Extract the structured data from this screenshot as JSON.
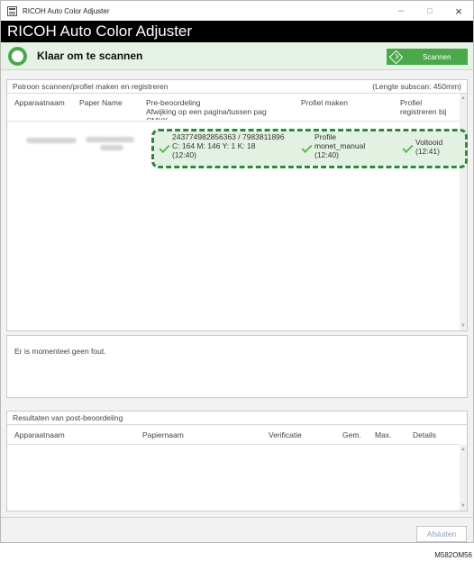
{
  "window": {
    "title": "RICOH Auto Color Adjuster",
    "controls": {
      "minimize": "–",
      "maximize": "□",
      "close": "×"
    }
  },
  "header": {
    "title": "RICOH Auto Color Adjuster"
  },
  "status": {
    "text": "Klaar om te scannen",
    "scan_button": "Scannen",
    "accent": "#4aa84a"
  },
  "scan_panel": {
    "title": "Patroon scannen/profiel maken en registreren",
    "length": "(Lengte subscan: 450mm)",
    "columns": {
      "device": "Apparaatnaam",
      "paper": "Paper Name",
      "pre_line1": "Pre-beoordeling",
      "pre_line2": "Afwijking op een pagina/tussen pag",
      "pre_line3": "CMYK",
      "profile_make": "Profiel maken",
      "profile_reg_line1": "Profiel",
      "profile_reg_line2": "registreren bij"
    },
    "row": {
      "pre_line1": "243774982856363 / 7983811896",
      "pre_line2": "C: 164 M: 146 Y: 1 K: 18",
      "pre_line3": "(12:40)",
      "profile_line1": "Profile",
      "profile_line2": "monet_manual",
      "profile_line3": "(12:40)",
      "reg_line1": "Voltooid",
      "reg_line2": "(12:41)"
    }
  },
  "error_panel": {
    "text": "Er is momenteel geen fout."
  },
  "post_panel": {
    "title": "Resultaten van post-beoordeling",
    "columns": {
      "device": "Apparaatnaam",
      "paper": "Papiernaam",
      "verification": "Verificatie",
      "avg": "Gem.",
      "max": "Max.",
      "details": "Details"
    }
  },
  "footer": {
    "close_button": "Afsluiten",
    "figure_code": "M582OM56"
  }
}
